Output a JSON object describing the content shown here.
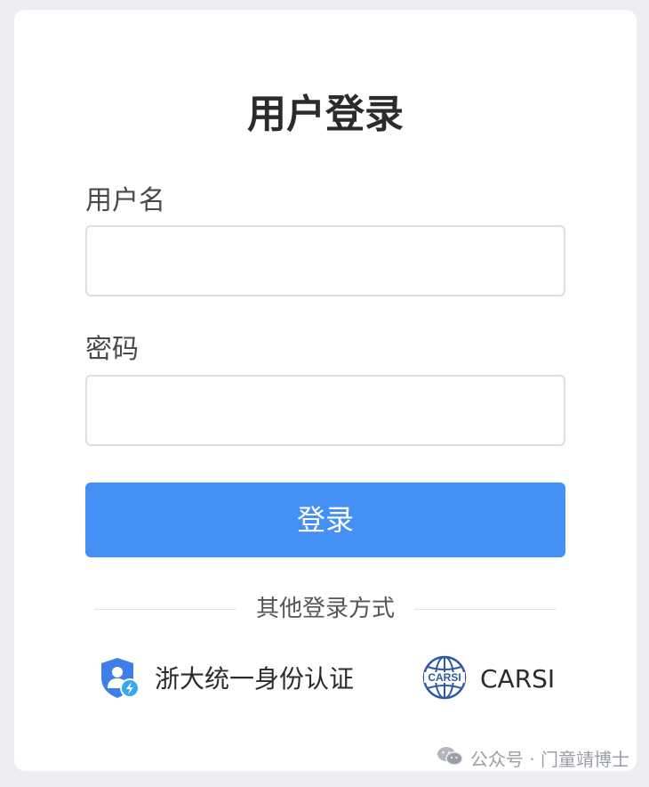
{
  "login": {
    "title": "用户登录",
    "username_label": "用户名",
    "username_value": "",
    "password_label": "密码",
    "password_value": "",
    "submit_label": "登录",
    "divider_text": "其他登录方式"
  },
  "alt_logins": [
    {
      "label": "浙大统一身份认证",
      "icon": "shield-user-icon"
    },
    {
      "label": "CARSI",
      "icon": "carsi-globe-icon",
      "logo_text": "CARSI"
    }
  ],
  "watermark": {
    "text": "公众号 · 门童靖博士",
    "icon": "wechat-icon"
  },
  "colors": {
    "primary": "#4590f5",
    "background": "#eceef2",
    "card": "#ffffff",
    "input_border": "#dcdfe6",
    "carsi_blue": "#2f58a8"
  }
}
